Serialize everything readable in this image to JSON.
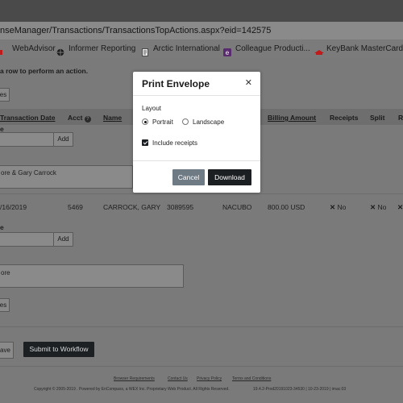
{
  "browser": {
    "url": "nseManager/Transactions/TransactionsTopActions.aspx?eid=142575",
    "bookmarks": [
      {
        "label": "WebAdvisor",
        "icon": "bookmark-icon"
      },
      {
        "label": "Informer Reporting",
        "icon": "globe-icon"
      },
      {
        "label": "Arctic International",
        "icon": "document-icon"
      },
      {
        "label": "Colleague Producti...",
        "icon": "e-app-icon"
      },
      {
        "label": "KeyBank MasterCard",
        "icon": "bank-icon"
      }
    ]
  },
  "page": {
    "instruction": "a row to perform an action.",
    "top_button": "es",
    "columns": {
      "transaction_date": "Transaction Date",
      "acct": "Acct",
      "name": "Name",
      "billing_amount": "Billing Amount",
      "receipts": "Receipts",
      "split": "Split",
      "r": "R"
    },
    "row1": {
      "label_e": "e",
      "add_label": "Add",
      "note": "ore & Gary Carrock"
    },
    "row2": {
      "date": "/16/2019",
      "acct": "5469",
      "name": "CARROCK, GARY",
      "number": "3089595",
      "vendor": "NACUBO",
      "amount": "800.00 USD",
      "receipts": "No",
      "split": "No",
      "label_e": "e",
      "add_label": "Add",
      "note": "ore",
      "small_btn": "es"
    },
    "save_label": "ave",
    "submit_label": "Submit to Workflow",
    "footer_links": [
      "Browser Requirements",
      "Contact Us",
      "Privacy Policy",
      "Terms and Conditions"
    ],
    "footer_text": "Copyright © 2005-2019 . Powered by EnCompass, a WEX Inc. Proprietary Web Product. All Rights Reserved.",
    "footer_version": "19.4.2-Prod20191023-34530 | 10-23-2019 | imac:03"
  },
  "modal": {
    "title": "Print Envelope",
    "layout_label": "Layout",
    "option_portrait": "Portrait",
    "option_landscape": "Landscape",
    "selected_layout": "Portrait",
    "include_receipts_label": "Include receipts",
    "include_receipts_checked": true,
    "cancel_label": "Cancel",
    "download_label": "Download"
  }
}
